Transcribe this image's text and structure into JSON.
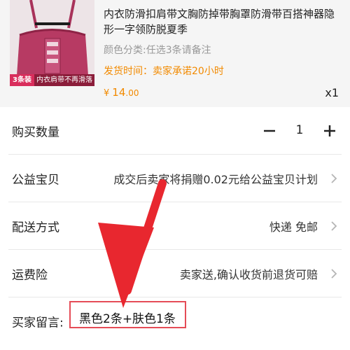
{
  "product": {
    "badge_count": "3条装",
    "badge_text": "内衣肩带不再滑落",
    "title": "内衣防滑扣肩带文胸防掉带胸罩防滑带百搭神器隐形一字领防脱夏季",
    "spec": "颜色分类:任选3条请备注",
    "shipping": "发货时间：卖家承诺20小时",
    "price_currency": "¥",
    "price_int": "14",
    "price_dec": ".00",
    "quantity": "x1"
  },
  "rows": {
    "quantity": {
      "label": "购买数量",
      "value": "1"
    },
    "charity": {
      "label": "公益宝贝",
      "value": "成交后卖家将捐赠0.02元给公益宝贝计划"
    },
    "delivery": {
      "label": "配送方式",
      "value": "快递 免邮"
    },
    "insurance": {
      "label": "运费险",
      "value": "卖家送,确认收货前退货可赔"
    },
    "message": {
      "label": "买家留言:",
      "value": "黑色2条+肤色1条"
    }
  },
  "colors": {
    "accent_orange": "#f28a00",
    "highlight_red": "#e8272f",
    "border_red": "#e54c57",
    "product_pink": "#b73a63"
  },
  "icons": [
    "product-thumbnail",
    "minus-icon",
    "plus-icon",
    "chevron-right-icon",
    "arrow-annotation"
  ]
}
